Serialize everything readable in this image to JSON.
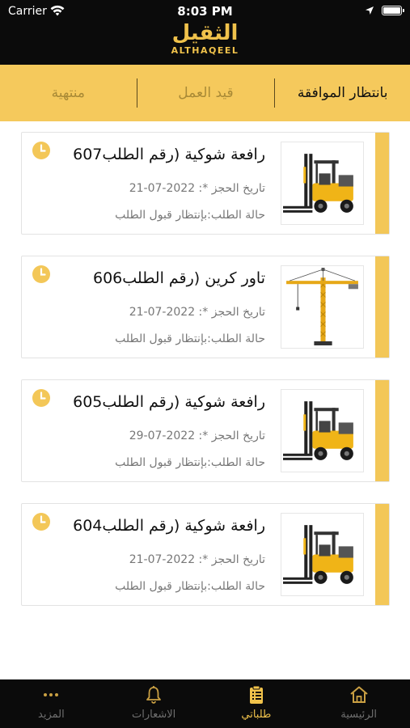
{
  "status_bar": {
    "carrier": "Carrier",
    "time": "8:03 PM"
  },
  "logo": {
    "arabic": "الثقيل",
    "english": "ALTHAQEEL"
  },
  "tabs": [
    {
      "label": "بانتظار الموافقة",
      "active": true
    },
    {
      "label": "قيد العمل",
      "active": false
    },
    {
      "label": "منتهية",
      "active": false
    }
  ],
  "requests": [
    {
      "title": "رافعة شوكية (رقم الطلب607",
      "date": "تاريخ الحجز *: 2022-07-21",
      "status": "حالة الطلب:بإنتظار قبول الطلب",
      "image": "forklift"
    },
    {
      "title": "تاور كرين (رقم الطلب606",
      "date": "تاريخ الحجز *: 2022-07-21",
      "status": "حالة الطلب:بإنتظار قبول الطلب",
      "image": "tower-crane"
    },
    {
      "title": "رافعة شوكية (رقم الطلب605",
      "date": "تاريخ الحجز *: 2022-07-29",
      "status": "حالة الطلب:بإنتظار قبول الطلب",
      "image": "forklift"
    },
    {
      "title": "رافعة شوكية (رقم الطلب604",
      "date": "تاريخ الحجز *: 2022-07-21",
      "status": "حالة الطلب:بإنتظار قبول الطلب",
      "image": "forklift"
    }
  ],
  "bottom_nav": [
    {
      "label": "الرئيسية",
      "icon": "home-icon",
      "active": false
    },
    {
      "label": "طلباتي",
      "icon": "clipboard-icon",
      "active": true
    },
    {
      "label": "الاشعارات",
      "icon": "bell-icon",
      "active": false
    },
    {
      "label": "المزيد",
      "icon": "more-dots-icon",
      "active": false
    }
  ],
  "colors": {
    "accent": "#f3c758",
    "header": "#0b0b0b",
    "inactive_tab": "#a98a36"
  }
}
